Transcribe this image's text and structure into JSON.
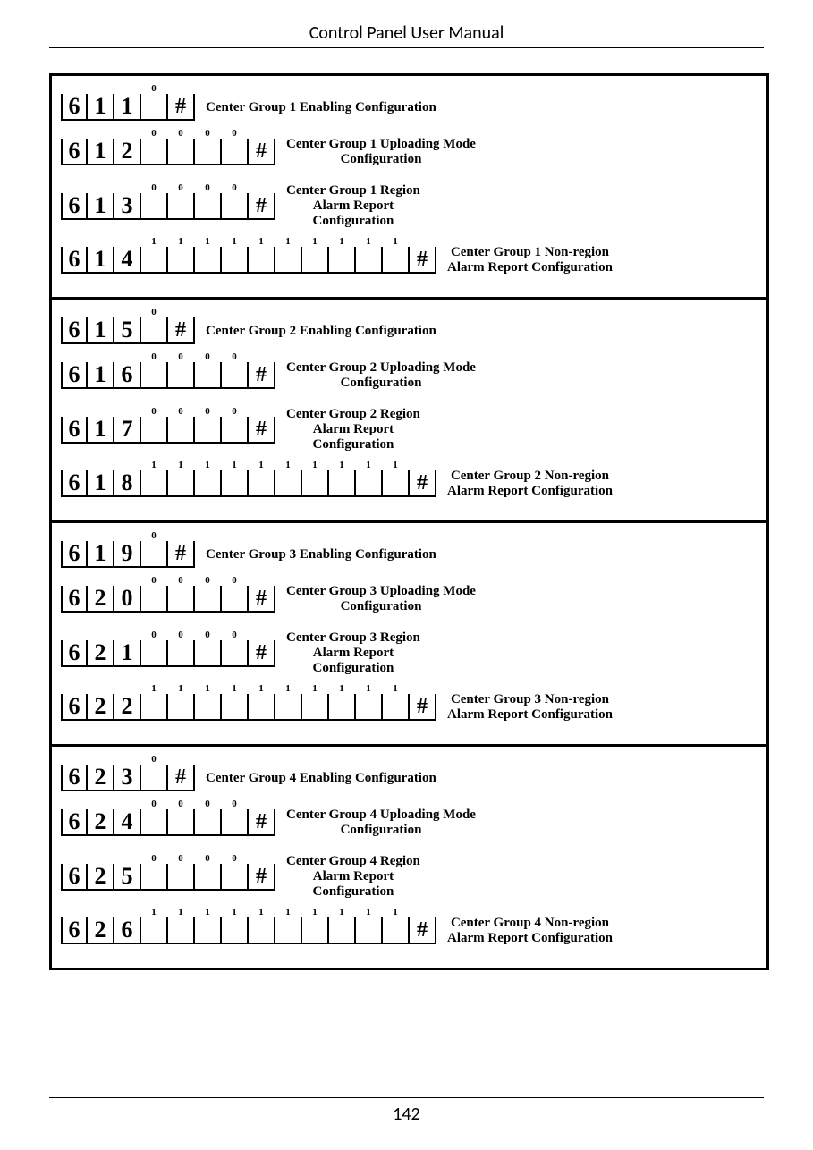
{
  "header": "Control Panel User Manual",
  "page_number": "142",
  "sections": [
    {
      "rows": [
        {
          "code": [
            "6",
            "1",
            "1"
          ],
          "sups": [
            "0"
          ],
          "desc_lines": [
            "Center Group 1 Enabling Configuration"
          ],
          "desc_align": "left"
        },
        {
          "code": [
            "6",
            "1",
            "2"
          ],
          "sups": [
            "0",
            "0",
            "0",
            "0"
          ],
          "desc_lines": [
            "Center Group 1 Uploading Mode",
            "Configuration"
          ],
          "desc_align": "center"
        },
        {
          "code": [
            "6",
            "1",
            "3"
          ],
          "sups": [
            "0",
            "0",
            "0",
            "0"
          ],
          "desc_lines": [
            "Center Group 1 Region",
            "Alarm Report",
            "Configuration"
          ],
          "desc_align": "center"
        },
        {
          "code": [
            "6",
            "1",
            "4"
          ],
          "sups": [
            "1",
            "1",
            "1",
            "1",
            "1",
            "1",
            "1",
            "1",
            "1",
            "1"
          ],
          "desc_lines": [
            "Center Group 1 Non-region",
            "Alarm Report Configuration"
          ],
          "desc_align": "center"
        }
      ]
    },
    {
      "rows": [
        {
          "code": [
            "6",
            "1",
            "5"
          ],
          "sups": [
            "0"
          ],
          "desc_lines": [
            "Center Group 2 Enabling Configuration"
          ],
          "desc_align": "left"
        },
        {
          "code": [
            "6",
            "1",
            "6"
          ],
          "sups": [
            "0",
            "0",
            "0",
            "0"
          ],
          "desc_lines": [
            "Center Group 2 Uploading Mode",
            "Configuration"
          ],
          "desc_align": "center"
        },
        {
          "code": [
            "6",
            "1",
            "7"
          ],
          "sups": [
            "0",
            "0",
            "0",
            "0"
          ],
          "desc_lines": [
            "Center Group 2 Region",
            "Alarm Report",
            "Configuration"
          ],
          "desc_align": "center"
        },
        {
          "code": [
            "6",
            "1",
            "8"
          ],
          "sups": [
            "1",
            "1",
            "1",
            "1",
            "1",
            "1",
            "1",
            "1",
            "1",
            "1"
          ],
          "desc_lines": [
            "Center Group 2 Non-region",
            "Alarm Report Configuration"
          ],
          "desc_align": "center"
        }
      ]
    },
    {
      "rows": [
        {
          "code": [
            "6",
            "1",
            "9"
          ],
          "sups": [
            "0"
          ],
          "desc_lines": [
            "Center Group 3 Enabling Configuration"
          ],
          "desc_align": "left"
        },
        {
          "code": [
            "6",
            "2",
            "0"
          ],
          "sups": [
            "0",
            "0",
            "0",
            "0"
          ],
          "desc_lines": [
            "Center Group 3 Uploading Mode",
            "Configuration"
          ],
          "desc_align": "center"
        },
        {
          "code": [
            "6",
            "2",
            "1"
          ],
          "sups": [
            "0",
            "0",
            "0",
            "0"
          ],
          "desc_lines": [
            "Center Group 3 Region",
            "Alarm Report",
            "Configuration"
          ],
          "desc_align": "center"
        },
        {
          "code": [
            "6",
            "2",
            "2"
          ],
          "sups": [
            "1",
            "1",
            "1",
            "1",
            "1",
            "1",
            "1",
            "1",
            "1",
            "1"
          ],
          "desc_lines": [
            "Center Group 3 Non-region",
            "Alarm Report Configuration"
          ],
          "desc_align": "center"
        }
      ]
    },
    {
      "rows": [
        {
          "code": [
            "6",
            "2",
            "3"
          ],
          "sups": [
            "0"
          ],
          "desc_lines": [
            "Center Group 4 Enabling Configuration"
          ],
          "desc_align": "left"
        },
        {
          "code": [
            "6",
            "2",
            "4"
          ],
          "sups": [
            "0",
            "0",
            "0",
            "0"
          ],
          "desc_lines": [
            "Center Group 4 Uploading Mode",
            "Configuration"
          ],
          "desc_align": "center"
        },
        {
          "code": [
            "6",
            "2",
            "5"
          ],
          "sups": [
            "0",
            "0",
            "0",
            "0"
          ],
          "desc_lines": [
            "Center Group 4 Region",
            "Alarm Report",
            "Configuration"
          ],
          "desc_align": "center"
        },
        {
          "code": [
            "6",
            "2",
            "6"
          ],
          "sups": [
            "1",
            "1",
            "1",
            "1",
            "1",
            "1",
            "1",
            "1",
            "1",
            "1"
          ],
          "desc_lines": [
            "Center Group 4 Non-region",
            "Alarm Report Configuration"
          ],
          "desc_align": "center"
        }
      ]
    }
  ],
  "hash": "#"
}
